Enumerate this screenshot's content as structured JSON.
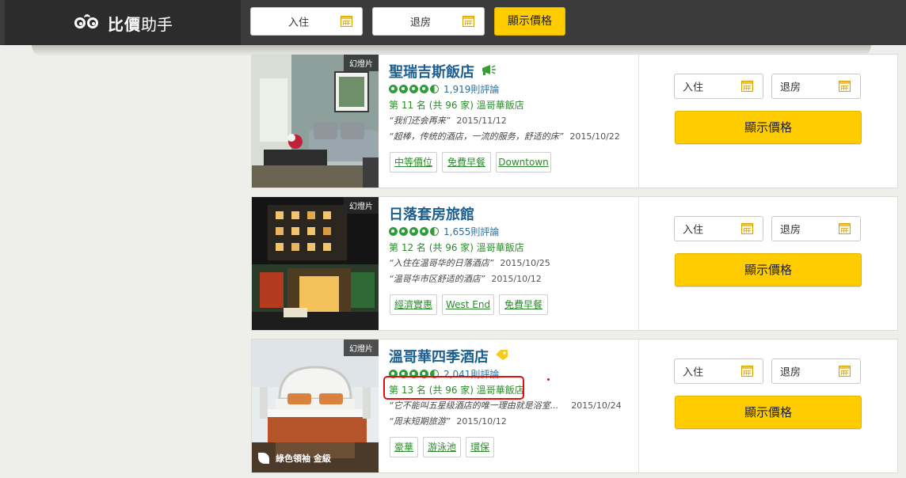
{
  "header": {
    "logo_text_bold": "比價",
    "logo_text": "助手",
    "checkin_label": "入住",
    "checkout_label": "退房",
    "show_price_label": "顯示價格"
  },
  "hotels": [
    {
      "slides_label": "幻燈片",
      "name": "聖瑞吉斯飯店",
      "reviews": "1,919則評論",
      "rank": "第 11 名 (共 96 家) 溫哥華飯店",
      "quotes": [
        {
          "text": "“我们还会再来”",
          "date": "2015/11/12"
        },
        {
          "text": "“超棒，传统的酒店，一流的服务，舒适的床”",
          "date": "2015/10/22"
        }
      ],
      "tags": [
        "中等價位",
        "免費早餐",
        "Downtown"
      ],
      "checkin_label": "入住",
      "checkout_label": "退房",
      "show_price_label": "顯示價格"
    },
    {
      "slides_label": "幻燈片",
      "name": "日落套房旅館",
      "reviews": "1,655則評論",
      "rank": "第 12 名 (共 96 家) 溫哥華飯店",
      "quotes": [
        {
          "text": "“入住在温哥华的日落酒店”",
          "date": "2015/10/25"
        },
        {
          "text": "“温哥华市区舒适的酒店”",
          "date": "2015/10/12"
        }
      ],
      "tags": [
        "經濟實惠",
        "West End",
        "免費早餐"
      ],
      "checkin_label": "入住",
      "checkout_label": "退房",
      "show_price_label": "顯示價格"
    },
    {
      "slides_label": "幻燈片",
      "name": "溫哥華四季酒店",
      "reviews": "2,041則評論",
      "rank": "第 13 名 (共 96 家) 溫哥華飯店",
      "quotes": [
        {
          "text": "“它不能叫五星级酒店的唯一理由就是浴室...",
          "date": "2015/10/24"
        },
        {
          "text": "“周末短期旅游”",
          "date": "2015/10/12"
        }
      ],
      "tags": [
        "豪華",
        "游泳池",
        "環保"
      ],
      "green_badge": "綠色領袖 金級",
      "checkin_label": "入住",
      "checkout_label": "退房",
      "show_price_label": "顯示價格"
    }
  ],
  "colors": {
    "accent_yellow": "#ffcc00",
    "link_blue": "#1b5f8f",
    "rating_green": "#2e9e3a",
    "header_dark": "#3b3b3b",
    "highlight_red": "#e01010"
  }
}
